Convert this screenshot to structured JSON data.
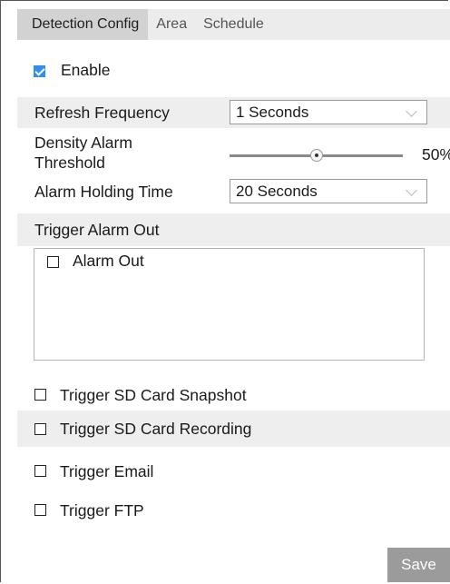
{
  "tabs": [
    {
      "label": "Detection Config"
    },
    {
      "label": "Area"
    },
    {
      "label": "Schedule"
    }
  ],
  "enable": {
    "label": "Enable",
    "checked": true
  },
  "refresh_frequency": {
    "label": "Refresh Frequency",
    "value": "1 Seconds"
  },
  "density_alarm": {
    "label_line1": "Density Alarm",
    "label_line2": "Threshold",
    "value": "50%",
    "level": 0.5
  },
  "alarm_holding": {
    "label": "Alarm Holding Time",
    "value": "20 Seconds"
  },
  "trigger_alarm_out": {
    "heading": "Trigger Alarm Out",
    "option": "Alarm Out",
    "checked": false
  },
  "triggers": [
    {
      "label": "Trigger SD Card Snapshot",
      "checked": false
    },
    {
      "label": "Trigger SD Card Recording",
      "checked": false
    },
    {
      "label": "Trigger Email",
      "checked": false
    },
    {
      "label": "Trigger FTP",
      "checked": false
    }
  ],
  "save_label": "Save",
  "colors": {
    "accent": "#2f8ef2",
    "button": "#9b9b9b",
    "row_shade": "#eeeeee"
  }
}
